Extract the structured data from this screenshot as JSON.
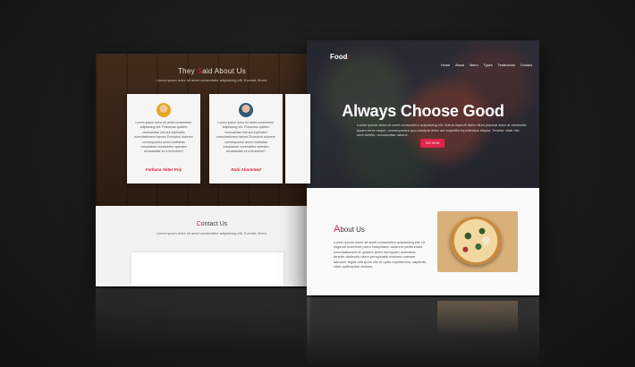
{
  "testimonials": {
    "title_accent": "S",
    "title_pre": "They ",
    "title_post": "aid About Us",
    "subtitle": "Lorem ipsum dolor sit amet consectetur adipisicing elit. Eveniet, libero.",
    "cards": [
      {
        "text": "Lorem ipsum dolor sit amet consectetur adipisicing elit. Possimus quidem recusandae nisi aut explicabo exercitationem harum! Excepturi dolorem consequuntur animi molestias voluptatum consectetur aperiam recusandae ex a inventore?",
        "name": "Farhana Akter Priy"
      },
      {
        "text": "Lorem ipsum dolor sit amet consectetur adipisicing elit. Possimus quidem recusandae nisi aut explicabo exercitationem harum! Excepturi dolorem consequuntur animi molestias voluptatum consectetur aperiam recusandae ex a inventore?",
        "name": "Ruhi Ahammed"
      }
    ]
  },
  "contact": {
    "title_accent": "C",
    "title_rest": "ontact Us",
    "subtitle": "Lorem ipsum dolor sit amet consectetur adipisicing elit. Eveniet, libero."
  },
  "site": {
    "brand": "Food",
    "brand_dot": ".",
    "nav": [
      "Home",
      "About",
      "Menu",
      "Types",
      "Testimonial",
      "Contact"
    ],
    "hero_title": "Always Choose Good",
    "hero_subtitle": "Lorem ipsum dolor sit amet consectetur adipisicing elit. Natus impedit libero illum placeat dolor at reiciendis ipsam error neque, consequuntur quo volutpat dolor aut expedita repellendus aliquid. Tenetur vitae nisi sunt debitis, recusandae ratione.",
    "hero_button": "GO NOW"
  },
  "about": {
    "title_accent": "A",
    "title_rest": "bout Us",
    "text": "Lorem ipsum dolor sit amet consectetur adipisicing elit. Ut eligendi inventore porro voluptatem dolorem perferendis exercitationem et quidem amet numquam molestias tenetur distinctio ullam perspiciatis maiores maxime laborum fugiat odit quos nisi et optio repellendus, sapiente, vitae quibusdam dolores."
  }
}
